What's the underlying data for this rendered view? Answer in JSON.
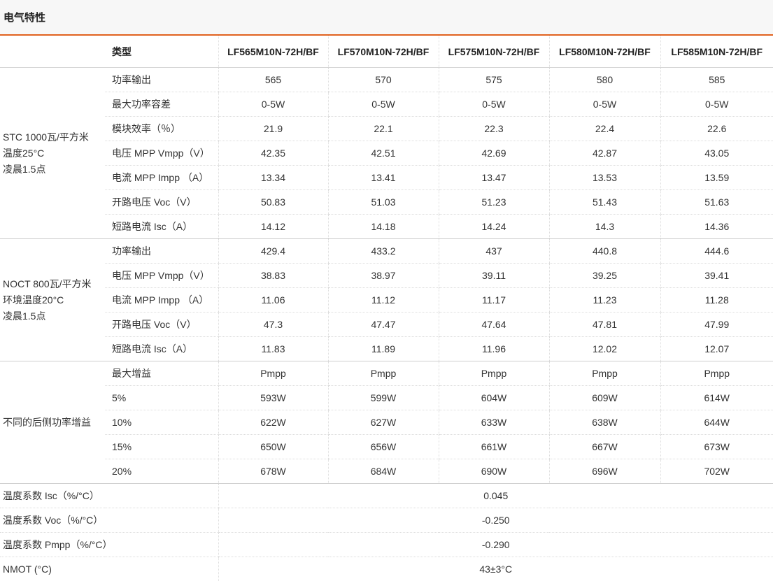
{
  "page": {
    "title": "电气特性"
  },
  "header": {
    "type_label": "类型",
    "models": [
      "LF565M10N-72H/BF",
      "LF570M10N-72H/BF",
      "LF575M10N-72H/BF",
      "LF580M10N-72H/BF",
      "LF585M10N-72H/BF"
    ]
  },
  "sections": [
    {
      "group_lines": [
        "STC 1000瓦/平方米",
        "温度25°C",
        "凌晨1.5点"
      ],
      "rows": [
        {
          "label": "功率输出",
          "values": [
            "565",
            "570",
            "575",
            "580",
            "585"
          ]
        },
        {
          "label": "最大功率容差",
          "values": [
            "0-5W",
            "0-5W",
            "0-5W",
            "0-5W",
            "0-5W"
          ]
        },
        {
          "label": "模块效率（％）",
          "values": [
            "21.9",
            "22.1",
            "22.3",
            "22.4",
            "22.6"
          ]
        },
        {
          "label": "电压 MPP Vmpp（V）",
          "values": [
            "42.35",
            "42.51",
            "42.69",
            "42.87",
            "43.05"
          ]
        },
        {
          "label": "电流 MPP Impp （A）",
          "values": [
            "13.34",
            "13.41",
            "13.47",
            "13.53",
            "13.59"
          ]
        },
        {
          "label": "开路电压 Voc（V）",
          "values": [
            "50.83",
            "51.03",
            "51.23",
            "51.43",
            "51.63"
          ]
        },
        {
          "label": "短路电流 Isc（A）",
          "values": [
            "14.12",
            "14.18",
            "14.24",
            "14.3",
            "14.36"
          ]
        }
      ]
    },
    {
      "group_lines": [
        "NOCT 800瓦/平方米",
        "环境温度20°C",
        "凌晨1.5点"
      ],
      "rows": [
        {
          "label": "功率输出",
          "values": [
            "429.4",
            "433.2",
            "437",
            "440.8",
            "444.6"
          ]
        },
        {
          "label": "电压 MPP Vmpp（V）",
          "values": [
            "38.83",
            "38.97",
            "39.11",
            "39.25",
            "39.41"
          ]
        },
        {
          "label": "电流 MPP Impp （A）",
          "values": [
            "11.06",
            "11.12",
            "11.17",
            "11.23",
            "11.28"
          ]
        },
        {
          "label": "开路电压 Voc（V）",
          "values": [
            "47.3",
            "47.47",
            "47.64",
            "47.81",
            "47.99"
          ]
        },
        {
          "label": "短路电流 Isc（A）",
          "values": [
            "11.83",
            "11.89",
            "11.96",
            "12.02",
            "12.07"
          ]
        }
      ]
    },
    {
      "group_lines": [
        "不同的后侧功率增益"
      ],
      "rows": [
        {
          "label": "最大增益",
          "values": [
            "Pmpp",
            "Pmpp",
            "Pmpp",
            "Pmpp",
            "Pmpp"
          ]
        },
        {
          "label": "5%",
          "values": [
            "593W",
            "599W",
            "604W",
            "609W",
            "614W"
          ]
        },
        {
          "label": "10%",
          "values": [
            "622W",
            "627W",
            "633W",
            "638W",
            "644W"
          ]
        },
        {
          "label": "15%",
          "values": [
            "650W",
            "656W",
            "661W",
            "667W",
            "673W"
          ]
        },
        {
          "label": "20%",
          "values": [
            "678W",
            "684W",
            "690W",
            "696W",
            "702W"
          ]
        }
      ]
    }
  ],
  "coefficients": [
    {
      "label": "温度系数 Isc（%/°C）",
      "value": "0.045"
    },
    {
      "label": "温度系数 Voc（%/°C）",
      "value": "-0.250"
    },
    {
      "label": "温度系数 Pmpp（%/°C）",
      "value": "-0.290"
    },
    {
      "label": "NMOT (°C)",
      "value": "43±3°C"
    }
  ]
}
